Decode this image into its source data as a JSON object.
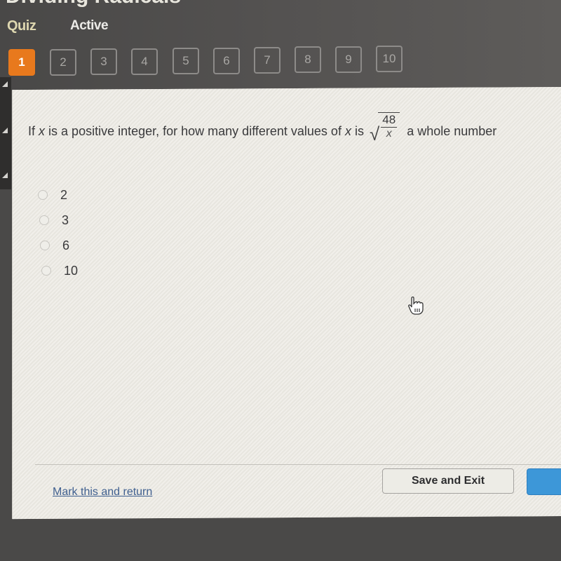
{
  "header": {
    "lesson_title": "Dividing Radicals",
    "quiz_label": "Quiz",
    "status": "Active"
  },
  "question_nav": {
    "current": 1,
    "items": [
      "1",
      "2",
      "3",
      "4",
      "5",
      "6",
      "7",
      "8",
      "9",
      "10"
    ]
  },
  "question": {
    "prefix": "If",
    "var1": "x",
    "middle": "is a positive integer, for how many different values of",
    "var2": "x",
    "is_word": "is",
    "radical_numerator": "48",
    "radical_denominator": "x",
    "suffix": "a whole number"
  },
  "choices": [
    {
      "label": "2",
      "selected": false
    },
    {
      "label": "3",
      "selected": false
    },
    {
      "label": "6",
      "selected": false
    },
    {
      "label": "10",
      "selected": false
    }
  ],
  "footer": {
    "mark_link": "Mark this and return",
    "save_exit": "Save and Exit"
  },
  "colors": {
    "active_question": "#e8791d",
    "next_button": "#3d97d8",
    "link": "#3f5f8f"
  }
}
